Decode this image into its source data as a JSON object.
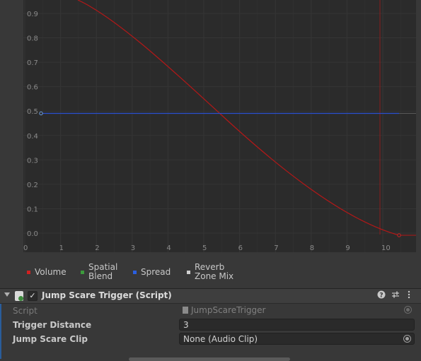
{
  "graph": {
    "y_ticks": [
      "0.9",
      "0.8",
      "0.7",
      "0.6",
      "0.5",
      "0.4",
      "0.3",
      "0.2",
      "0.1",
      "0.0"
    ],
    "x_ticks": [
      "0",
      "1",
      "2",
      "3",
      "4",
      "5",
      "6",
      "7",
      "8",
      "9",
      "10"
    ],
    "colors": {
      "volume": "#b31818",
      "spread": "#2a4fd0",
      "spatial": "#3a8a3a",
      "reverb": "#cccccc",
      "listener": "#8a1c1c"
    }
  },
  "legend": {
    "items": [
      {
        "label": "Volume",
        "color": "#d12020"
      },
      {
        "label": "Spatial Blend",
        "color": "#3c9a3c"
      },
      {
        "label": "Spread",
        "color": "#2a5fe0"
      },
      {
        "label": "Reverb Zone Mix",
        "color": "#cfcfcf"
      }
    ]
  },
  "component": {
    "title": "Jump Scare Trigger (Script)",
    "help_icon": "help-icon",
    "preset_icon": "preset-icon",
    "menu_icon": "kebab-menu-icon",
    "enabled": "✓",
    "properties": [
      {
        "label": "Script",
        "value": "JumpScareTrigger"
      },
      {
        "label": "Trigger Distance",
        "value": "3"
      },
      {
        "label": "Jump Scare Clip",
        "value": "None (Audio Clip)"
      }
    ]
  }
}
